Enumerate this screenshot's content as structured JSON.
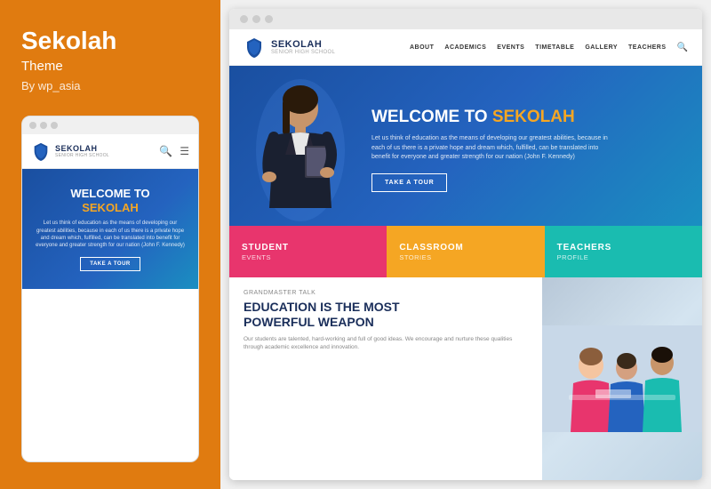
{
  "left": {
    "theme_title": "Sekolah",
    "theme_subtitle": "Theme",
    "author": "By wp_asia",
    "mobile": {
      "logo_main": "SEKOLAH",
      "logo_sub": "SENIOR HIGH SCHOOL",
      "hero_title_line1": "WELCOME TO",
      "hero_title_line2": "SEKOLAH",
      "hero_desc": "Let us think of education as the means of developing our greatest abilities, because in each of us there is a private hope and dream which, fulfilled, can be translated into benefit for everyone and greater strength for our nation (John F. Kennedy)",
      "cta_label": "TAKE A TOUR"
    }
  },
  "right": {
    "browser_dots": [
      "dot1",
      "dot2",
      "dot3"
    ],
    "nav": {
      "logo_main": "SEKOLAH",
      "logo_sub": "SENIOR HIGH SCHOOL",
      "links": [
        "ABOUT",
        "ACADEMICS",
        "EVENTS",
        "TIMETABLE",
        "GALLERY",
        "TEACHERS"
      ]
    },
    "hero": {
      "title_prefix": "WELCOME TO",
      "title_accent": "SEKOLAH",
      "description": "Let us think of education as the means of developing our greatest abilities, because in each of us there is a private hope and dream which, fulfilled, can be translated into benefit for everyone and greater strength for our nation (John F. Kennedy)",
      "cta_label": "TAKE A TOUR"
    },
    "strips": [
      {
        "title": "STUDENT",
        "subtitle": "EVENTS"
      },
      {
        "title": "CLASSROOM",
        "subtitle": "STORIES"
      },
      {
        "title": "TEACHERS",
        "subtitle": "PROFILE"
      }
    ],
    "bottom": {
      "tag": "Grandmaster Talk",
      "heading_line1": "EDUCATION IS THE MOST",
      "heading_line2": "POWERFUL WEAPON",
      "description": "Our students are talented, hard-working and full of good ideas. We encourage and nurture these qualities through academic excellence and innovation."
    }
  },
  "colors": {
    "orange": "#e07b10",
    "blue_dark": "#1a4fa0",
    "blue_mid": "#2463bf",
    "teal": "#1abcb0",
    "pink": "#e8356d",
    "amber": "#f5a623",
    "white": "#ffffff",
    "navy": "#1a2e5a"
  }
}
